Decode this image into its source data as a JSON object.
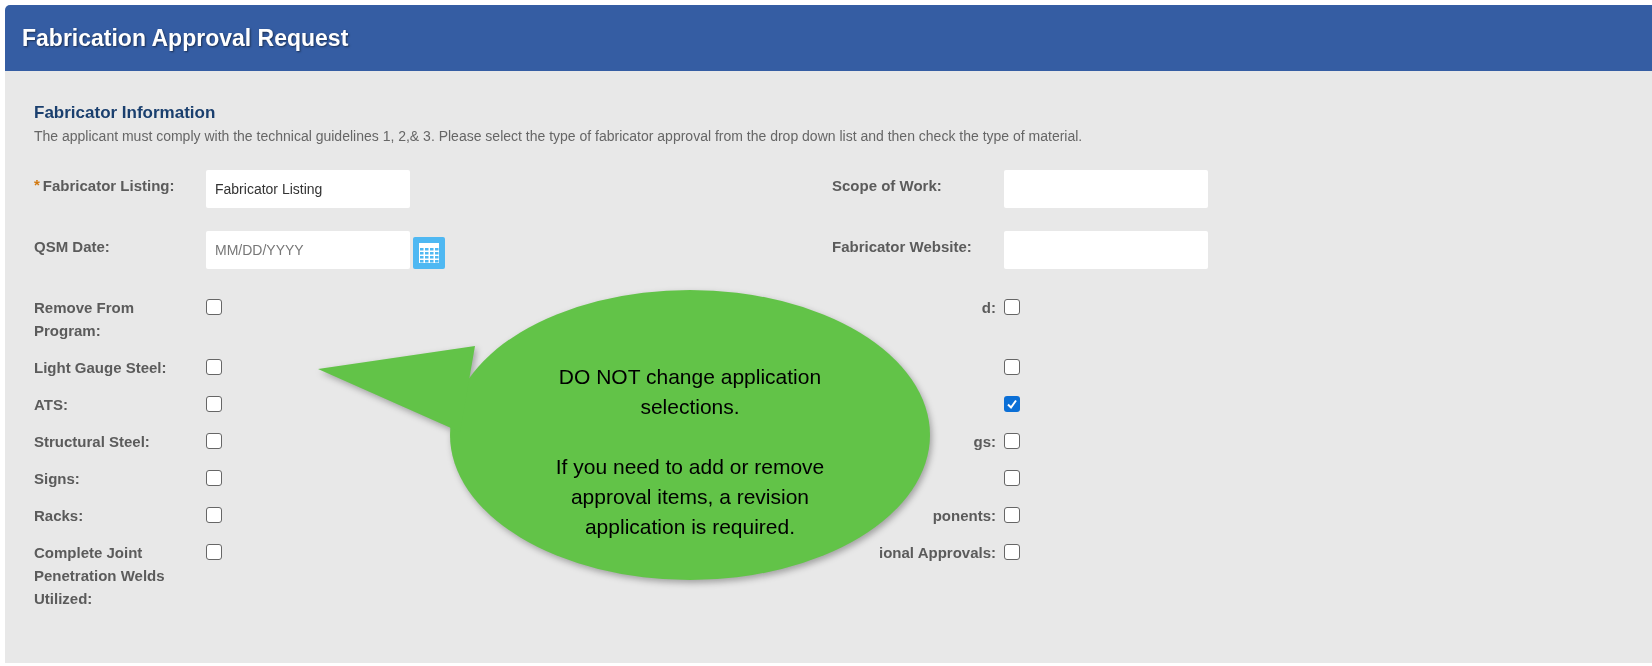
{
  "header": {
    "title": "Fabrication Approval Request"
  },
  "section": {
    "title": "Fabricator Information",
    "description": "The applicant must comply with the technical guidelines 1, 2,& 3. Please select the type of fabricator approval from the drop down list and then check the type of material."
  },
  "left_fields": [
    {
      "kind": "text",
      "label": "Fabricator Listing:",
      "required_mark": "*",
      "value": "Fabricator Listing"
    },
    {
      "kind": "date",
      "label": "QSM Date:",
      "placeholder": "MM/DD/YYYY"
    },
    {
      "kind": "checkbox",
      "label": "Remove From Program:",
      "checked": false
    },
    {
      "kind": "checkbox",
      "label": "Light Gauge Steel:",
      "checked": false
    },
    {
      "kind": "checkbox",
      "label": "ATS:",
      "checked": false
    },
    {
      "kind": "checkbox",
      "label": "Structural Steel:",
      "checked": false
    },
    {
      "kind": "checkbox",
      "label": "Signs:",
      "checked": false
    },
    {
      "kind": "checkbox",
      "label": "Racks:",
      "checked": false
    },
    {
      "kind": "checkbox",
      "label": "Complete Joint Penetration Welds Utilized:",
      "checked": false
    }
  ],
  "right_fields": [
    {
      "kind": "text",
      "label": "Scope of Work:"
    },
    {
      "kind": "text",
      "label": "Fabricator Website:"
    },
    {
      "kind": "checkbox",
      "label": "d:",
      "checked": false
    },
    {
      "kind": "checkbox",
      "checked": false
    },
    {
      "kind": "checkbox",
      "checked": true
    },
    {
      "kind": "checkbox",
      "label": "gs:",
      "checked": false
    },
    {
      "kind": "checkbox",
      "checked": false
    },
    {
      "kind": "checkbox",
      "label": "ponents:",
      "checked": false
    },
    {
      "kind": "checkbox",
      "label": "ional Approvals:",
      "checked": false
    }
  ],
  "callout": {
    "paragraphs": [
      "DO NOT change application selections.",
      "If you need to add or remove approval items, a revision application is required."
    ]
  }
}
